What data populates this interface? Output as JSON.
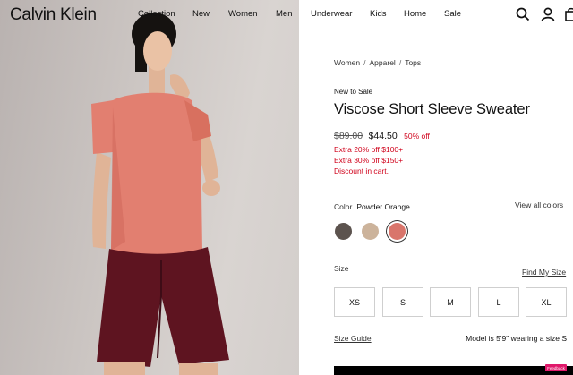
{
  "brand": {
    "logo": "Calvin Klein"
  },
  "nav": {
    "items": [
      "Collection",
      "New",
      "Women",
      "Men",
      "Underwear",
      "Kids",
      "Home",
      "Sale"
    ]
  },
  "header_icons": [
    "search-icon",
    "account-icon",
    "bag-icon"
  ],
  "breadcrumb": [
    "Women",
    "Apparel",
    "Tops"
  ],
  "breadcrumb_separator": "/",
  "product": {
    "badge": "New to Sale",
    "title": "Viscose Short Sleeve Sweater",
    "price_original": "$89.00",
    "price_current": "$44.50",
    "discount": "50% off",
    "promos": [
      "Extra 20% off $100+",
      "Extra 30% off $150+",
      "Discount in cart."
    ]
  },
  "color": {
    "label": "Color",
    "selected": "Powder Orange",
    "view_all": "View all colors",
    "swatches": [
      {
        "name": "heather-brown",
        "hex": "#5c534e"
      },
      {
        "name": "oatmeal",
        "hex": "#ccb39b"
      },
      {
        "name": "powder-orange",
        "hex": "#d9756b"
      }
    ]
  },
  "size": {
    "label": "Size",
    "find_my_size": "Find My Size",
    "options": [
      "XS",
      "S",
      "M",
      "L",
      "XL"
    ],
    "guide": "Size Guide",
    "model_info": "Model is 5'9\" wearing a size S"
  },
  "feedback_tab": "Feedback",
  "colors": {
    "sale_red": "#d0021b",
    "sweater": "#e27f70",
    "shorts": "#5e1420"
  }
}
